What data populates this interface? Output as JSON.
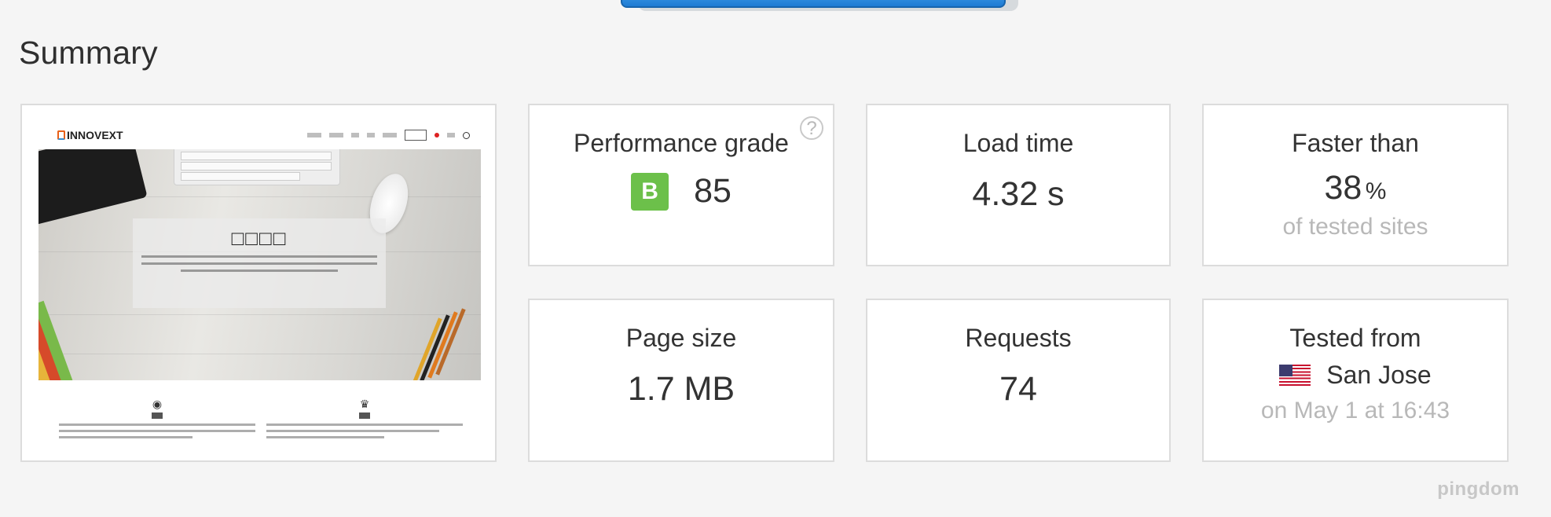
{
  "page": {
    "title": "Summary",
    "footer_brand": "pingdom"
  },
  "screenshot": {
    "logo_text": "INNOVEXT",
    "hero_title": "□□□□"
  },
  "metrics": {
    "performance": {
      "label": "Performance grade",
      "grade": "B",
      "score": "85",
      "help": "?",
      "grade_color": "#6cc04a"
    },
    "load_time": {
      "label": "Load time",
      "value": "4.32 s"
    },
    "faster_than": {
      "label": "Faster than",
      "value": "38",
      "unit": "%",
      "sub": "of tested sites"
    },
    "page_size": {
      "label": "Page size",
      "value": "1.7 MB"
    },
    "requests": {
      "label": "Requests",
      "value": "74"
    },
    "tested_from": {
      "label": "Tested from",
      "location": "San Jose",
      "sub": "on May 1 at 16:43",
      "flag_icon": "us-flag-icon"
    }
  },
  "colors": {
    "accent_blue": "#1f7bd4",
    "grade_green": "#6cc04a",
    "muted_text": "#b8b8b8"
  }
}
